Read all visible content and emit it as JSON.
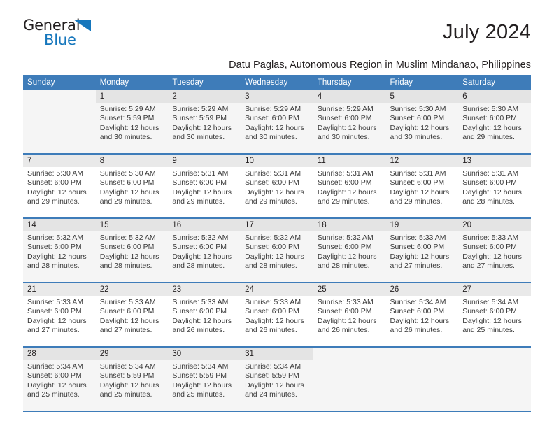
{
  "brand": {
    "name_part1": "General",
    "name_part2": "Blue",
    "accent_color": "#1576bc"
  },
  "header": {
    "month_title": "July 2024",
    "subtitle": "Datu Paglas, Autonomous Region in Muslim Mindanao, Philippines",
    "header_bg_color": "#3e7cb9"
  },
  "weekday_headers": [
    "Sunday",
    "Monday",
    "Tuesday",
    "Wednesday",
    "Thursday",
    "Friday",
    "Saturday"
  ],
  "weeks": [
    {
      "shaded": true,
      "days": [
        {
          "num": "",
          "sunrise": "",
          "sunset": "",
          "daylight_line1": "",
          "daylight_line2": ""
        },
        {
          "num": "1",
          "sunrise": "Sunrise: 5:29 AM",
          "sunset": "Sunset: 5:59 PM",
          "daylight_line1": "Daylight: 12 hours",
          "daylight_line2": "and 30 minutes."
        },
        {
          "num": "2",
          "sunrise": "Sunrise: 5:29 AM",
          "sunset": "Sunset: 5:59 PM",
          "daylight_line1": "Daylight: 12 hours",
          "daylight_line2": "and 30 minutes."
        },
        {
          "num": "3",
          "sunrise": "Sunrise: 5:29 AM",
          "sunset": "Sunset: 6:00 PM",
          "daylight_line1": "Daylight: 12 hours",
          "daylight_line2": "and 30 minutes."
        },
        {
          "num": "4",
          "sunrise": "Sunrise: 5:29 AM",
          "sunset": "Sunset: 6:00 PM",
          "daylight_line1": "Daylight: 12 hours",
          "daylight_line2": "and 30 minutes."
        },
        {
          "num": "5",
          "sunrise": "Sunrise: 5:30 AM",
          "sunset": "Sunset: 6:00 PM",
          "daylight_line1": "Daylight: 12 hours",
          "daylight_line2": "and 30 minutes."
        },
        {
          "num": "6",
          "sunrise": "Sunrise: 5:30 AM",
          "sunset": "Sunset: 6:00 PM",
          "daylight_line1": "Daylight: 12 hours",
          "daylight_line2": "and 29 minutes."
        }
      ]
    },
    {
      "shaded": false,
      "days": [
        {
          "num": "7",
          "sunrise": "Sunrise: 5:30 AM",
          "sunset": "Sunset: 6:00 PM",
          "daylight_line1": "Daylight: 12 hours",
          "daylight_line2": "and 29 minutes."
        },
        {
          "num": "8",
          "sunrise": "Sunrise: 5:30 AM",
          "sunset": "Sunset: 6:00 PM",
          "daylight_line1": "Daylight: 12 hours",
          "daylight_line2": "and 29 minutes."
        },
        {
          "num": "9",
          "sunrise": "Sunrise: 5:31 AM",
          "sunset": "Sunset: 6:00 PM",
          "daylight_line1": "Daylight: 12 hours",
          "daylight_line2": "and 29 minutes."
        },
        {
          "num": "10",
          "sunrise": "Sunrise: 5:31 AM",
          "sunset": "Sunset: 6:00 PM",
          "daylight_line1": "Daylight: 12 hours",
          "daylight_line2": "and 29 minutes."
        },
        {
          "num": "11",
          "sunrise": "Sunrise: 5:31 AM",
          "sunset": "Sunset: 6:00 PM",
          "daylight_line1": "Daylight: 12 hours",
          "daylight_line2": "and 29 minutes."
        },
        {
          "num": "12",
          "sunrise": "Sunrise: 5:31 AM",
          "sunset": "Sunset: 6:00 PM",
          "daylight_line1": "Daylight: 12 hours",
          "daylight_line2": "and 29 minutes."
        },
        {
          "num": "13",
          "sunrise": "Sunrise: 5:31 AM",
          "sunset": "Sunset: 6:00 PM",
          "daylight_line1": "Daylight: 12 hours",
          "daylight_line2": "and 28 minutes."
        }
      ]
    },
    {
      "shaded": true,
      "days": [
        {
          "num": "14",
          "sunrise": "Sunrise: 5:32 AM",
          "sunset": "Sunset: 6:00 PM",
          "daylight_line1": "Daylight: 12 hours",
          "daylight_line2": "and 28 minutes."
        },
        {
          "num": "15",
          "sunrise": "Sunrise: 5:32 AM",
          "sunset": "Sunset: 6:00 PM",
          "daylight_line1": "Daylight: 12 hours",
          "daylight_line2": "and 28 minutes."
        },
        {
          "num": "16",
          "sunrise": "Sunrise: 5:32 AM",
          "sunset": "Sunset: 6:00 PM",
          "daylight_line1": "Daylight: 12 hours",
          "daylight_line2": "and 28 minutes."
        },
        {
          "num": "17",
          "sunrise": "Sunrise: 5:32 AM",
          "sunset": "Sunset: 6:00 PM",
          "daylight_line1": "Daylight: 12 hours",
          "daylight_line2": "and 28 minutes."
        },
        {
          "num": "18",
          "sunrise": "Sunrise: 5:32 AM",
          "sunset": "Sunset: 6:00 PM",
          "daylight_line1": "Daylight: 12 hours",
          "daylight_line2": "and 28 minutes."
        },
        {
          "num": "19",
          "sunrise": "Sunrise: 5:33 AM",
          "sunset": "Sunset: 6:00 PM",
          "daylight_line1": "Daylight: 12 hours",
          "daylight_line2": "and 27 minutes."
        },
        {
          "num": "20",
          "sunrise": "Sunrise: 5:33 AM",
          "sunset": "Sunset: 6:00 PM",
          "daylight_line1": "Daylight: 12 hours",
          "daylight_line2": "and 27 minutes."
        }
      ]
    },
    {
      "shaded": false,
      "days": [
        {
          "num": "21",
          "sunrise": "Sunrise: 5:33 AM",
          "sunset": "Sunset: 6:00 PM",
          "daylight_line1": "Daylight: 12 hours",
          "daylight_line2": "and 27 minutes."
        },
        {
          "num": "22",
          "sunrise": "Sunrise: 5:33 AM",
          "sunset": "Sunset: 6:00 PM",
          "daylight_line1": "Daylight: 12 hours",
          "daylight_line2": "and 27 minutes."
        },
        {
          "num": "23",
          "sunrise": "Sunrise: 5:33 AM",
          "sunset": "Sunset: 6:00 PM",
          "daylight_line1": "Daylight: 12 hours",
          "daylight_line2": "and 26 minutes."
        },
        {
          "num": "24",
          "sunrise": "Sunrise: 5:33 AM",
          "sunset": "Sunset: 6:00 PM",
          "daylight_line1": "Daylight: 12 hours",
          "daylight_line2": "and 26 minutes."
        },
        {
          "num": "25",
          "sunrise": "Sunrise: 5:33 AM",
          "sunset": "Sunset: 6:00 PM",
          "daylight_line1": "Daylight: 12 hours",
          "daylight_line2": "and 26 minutes."
        },
        {
          "num": "26",
          "sunrise": "Sunrise: 5:34 AM",
          "sunset": "Sunset: 6:00 PM",
          "daylight_line1": "Daylight: 12 hours",
          "daylight_line2": "and 26 minutes."
        },
        {
          "num": "27",
          "sunrise": "Sunrise: 5:34 AM",
          "sunset": "Sunset: 6:00 PM",
          "daylight_line1": "Daylight: 12 hours",
          "daylight_line2": "and 25 minutes."
        }
      ]
    },
    {
      "shaded": true,
      "days": [
        {
          "num": "28",
          "sunrise": "Sunrise: 5:34 AM",
          "sunset": "Sunset: 6:00 PM",
          "daylight_line1": "Daylight: 12 hours",
          "daylight_line2": "and 25 minutes."
        },
        {
          "num": "29",
          "sunrise": "Sunrise: 5:34 AM",
          "sunset": "Sunset: 5:59 PM",
          "daylight_line1": "Daylight: 12 hours",
          "daylight_line2": "and 25 minutes."
        },
        {
          "num": "30",
          "sunrise": "Sunrise: 5:34 AM",
          "sunset": "Sunset: 5:59 PM",
          "daylight_line1": "Daylight: 12 hours",
          "daylight_line2": "and 25 minutes."
        },
        {
          "num": "31",
          "sunrise": "Sunrise: 5:34 AM",
          "sunset": "Sunset: 5:59 PM",
          "daylight_line1": "Daylight: 12 hours",
          "daylight_line2": "and 24 minutes."
        },
        {
          "num": "",
          "sunrise": "",
          "sunset": "",
          "daylight_line1": "",
          "daylight_line2": ""
        },
        {
          "num": "",
          "sunrise": "",
          "sunset": "",
          "daylight_line1": "",
          "daylight_line2": ""
        },
        {
          "num": "",
          "sunrise": "",
          "sunset": "",
          "daylight_line1": "",
          "daylight_line2": ""
        }
      ]
    }
  ]
}
